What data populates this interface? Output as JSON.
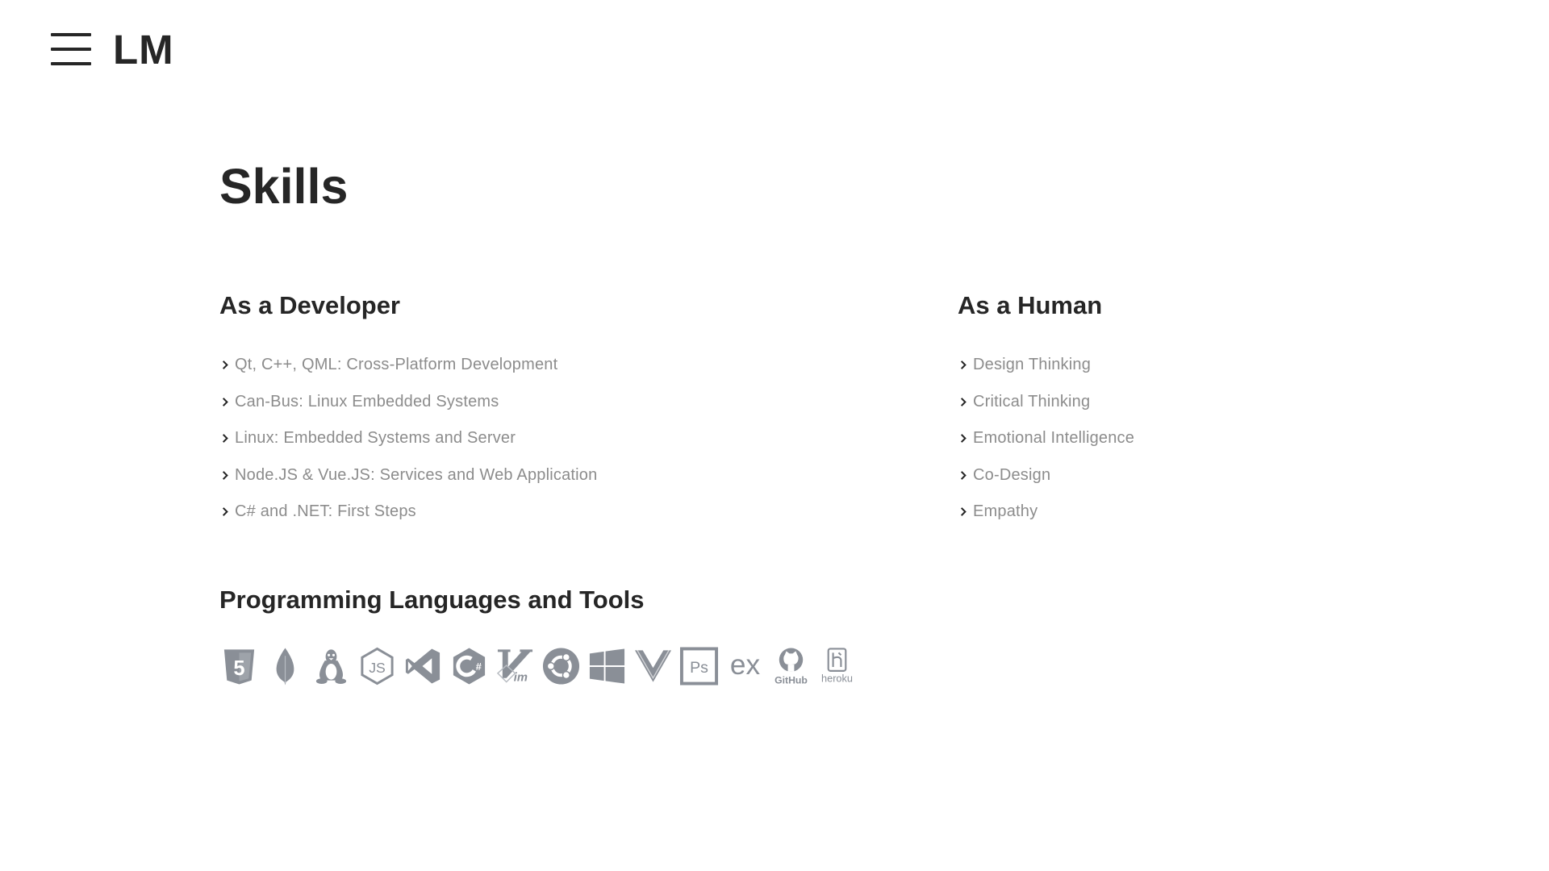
{
  "header": {
    "menu_icon": "hamburger-menu-icon",
    "logo": "LM"
  },
  "page_title": "Skills",
  "developer": {
    "heading": "As a Developer",
    "items": [
      "Qt, C++, QML: Cross-Platform Development",
      "Can-Bus: Linux Embedded Systems",
      "Linux: Embedded Systems and Server",
      "Node.JS & Vue.JS: Services and Web Application",
      "C# and .NET: First Steps"
    ]
  },
  "human": {
    "heading": "As a Human",
    "items": [
      "Design Thinking",
      "Critical Thinking",
      "Emotional Intelligence",
      "Co-Design",
      "Empathy"
    ]
  },
  "tools": {
    "heading": "Programming Languages and Tools",
    "icons": [
      "html5-icon",
      "mongodb-icon",
      "linux-icon",
      "nodejs-icon",
      "visual-studio-icon",
      "csharp-icon",
      "vim-icon",
      "ubuntu-icon",
      "windows-icon",
      "vuejs-icon",
      "photoshop-icon",
      "express-icon",
      "github-icon",
      "heroku-icon"
    ],
    "icon_labels": {
      "photoshop": "Ps",
      "express": "ex",
      "github": "GitHub",
      "heroku": "heroku",
      "vim": "im",
      "nodejs": "JS",
      "html5": "5"
    }
  },
  "colors": {
    "text": "#262626",
    "muted": "#8c8c8c",
    "icon": "#8a8f97"
  }
}
